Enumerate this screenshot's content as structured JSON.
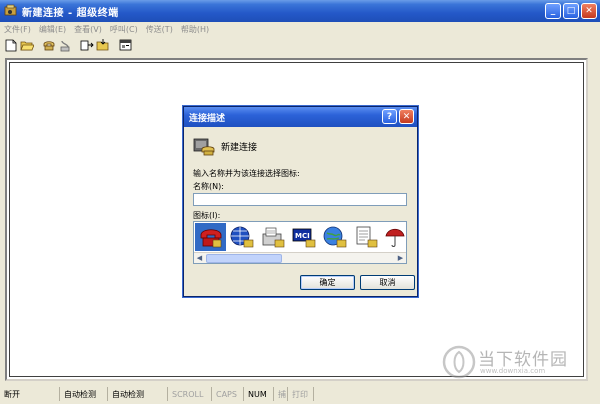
{
  "window": {
    "title": "新建连接 - 超级终端",
    "buttons": {
      "minimize": "_",
      "maximize": "□",
      "close": "✕"
    }
  },
  "menubar": {
    "items": [
      {
        "label": "文件(F)"
      },
      {
        "label": "编辑(E)"
      },
      {
        "label": "查看(V)"
      },
      {
        "label": "呼叫(C)"
      },
      {
        "label": "传送(T)"
      },
      {
        "label": "帮助(H)"
      }
    ]
  },
  "toolbar": {
    "icons": [
      "new-icon",
      "open-icon",
      "connect-icon",
      "disconnect-icon",
      "send-icon",
      "receive-icon",
      "properties-icon"
    ]
  },
  "dialog": {
    "title": "连接描述",
    "help_button": "?",
    "close_button": "✕",
    "heading": "新建连接",
    "prompt": "输入名称并为该连接选择图标:",
    "name_label": "名称(N):",
    "name_value": "",
    "icon_label": "图标(I):",
    "icons": [
      "phone-icon",
      "globe-icon",
      "fax-icon",
      "mci-icon",
      "globe-phone-icon",
      "document-icon",
      "umbrella-icon"
    ],
    "mci_text": "MCI",
    "ok_label": "确定",
    "cancel_label": "取消"
  },
  "statusbar": {
    "cells": [
      {
        "label": "断开",
        "dim": false
      },
      {
        "label": "自动检测",
        "dim": false
      },
      {
        "label": "自动检测",
        "dim": false
      },
      {
        "label": "SCROLL",
        "dim": true
      },
      {
        "label": "CAPS",
        "dim": true
      },
      {
        "label": "NUM",
        "dim": false
      },
      {
        "label": "捕",
        "dim": true
      },
      {
        "label": "打印",
        "dim": true
      }
    ]
  },
  "watermark": {
    "brand": "当下软件园",
    "url": "www.downxia.com"
  },
  "colors": {
    "titlebar": "#2458c8",
    "face": "#ece9d8",
    "selection": "#316ac5"
  }
}
